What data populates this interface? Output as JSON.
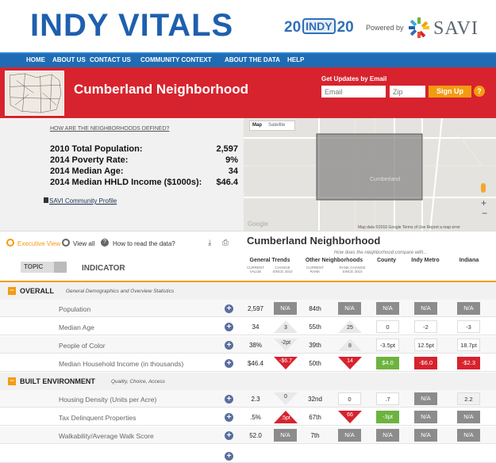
{
  "header": {
    "logo": "INDY VITALS",
    "indy20_left": "20",
    "indy20_mid": "INDY",
    "indy20_right": "20",
    "powered_by": "Powered by",
    "savi": "SAVI"
  },
  "nav": {
    "items": [
      "HOME",
      "ABOUT US",
      "CONTACT US",
      "COMMUNITY CONTEXT",
      "ABOUT THE DATA",
      "HELP"
    ]
  },
  "banner": {
    "title": "Cumberland Neighborhood",
    "updates_label": "Get Updates by Email",
    "email_placeholder": "Email",
    "zip_placeholder": "Zip",
    "signup": "Sign Up",
    "help": "?"
  },
  "stats": {
    "defined_link": "HOW ARE THE NEIGHBORHOODS DEFINED?",
    "items": [
      {
        "label": "2010 Total Population:",
        "value": "2,597"
      },
      {
        "label": "2014 Poverty Rate:",
        "value": "9%"
      },
      {
        "label": "2014 Median Age:",
        "value": "34"
      },
      {
        "label": "2014 Median HHLD Income ($1000s):",
        "value": "$46.4"
      }
    ],
    "profile_link": "SAVI Community Profile"
  },
  "map": {
    "tab_map": "Map",
    "tab_satellite": "Satellite",
    "label": "Cumberland",
    "footer": "Map data ©2016 Google   Terms of Use   Report a map error",
    "google": "Google"
  },
  "controls": {
    "executive_view": "Executive View",
    "view_all": "View all",
    "how_to_read": "How to read the data?",
    "section_title": "Cumberland Neighborhood",
    "compare_note": "How does the neighborhood compare with..."
  },
  "table_header": {
    "topic": "TOPIC",
    "indicator": "INDICATOR",
    "general_trends": "General Trends",
    "other_neighborhoods": "Other Neighborhoods",
    "county": "County",
    "indy_metro": "Indy Metro",
    "indiana": "Indiana",
    "sub_current_value": "CURRENT VALUE",
    "sub_change_since": "CHANGE SINCE 2010",
    "sub_current_rank": "CURRENT RANK",
    "sub_rank_change": "RANK CHANGE SINCE 2010"
  },
  "sections": [
    {
      "title": "OVERALL",
      "subtitle": "General Demographics and Overview Statistics",
      "rows": [
        {
          "indicator": "Population",
          "value": "2,597",
          "change": "N/A",
          "rank": "84th",
          "rank_change": "N/A",
          "county": "N/A",
          "metro": "N/A",
          "indiana": "N/A"
        },
        {
          "indicator": "Median Age",
          "value": "34",
          "change": "3",
          "rank": "55th",
          "rank_change": "25",
          "county": "0",
          "metro": "-2",
          "indiana": "-3"
        },
        {
          "indicator": "People of Color",
          "value": "38%",
          "change": "-2pt",
          "rank": "39th",
          "rank_change": "8",
          "county": "-3.5pt",
          "metro": "12.5pt",
          "indiana": "18.7pt"
        },
        {
          "indicator": "Median Household Income (in thousands)",
          "value": "$46.4",
          "change": "-$6.7",
          "rank": "50th",
          "rank_change": "14",
          "county": "$4.0",
          "metro": "-$6.0",
          "indiana": "-$2.3"
        }
      ]
    },
    {
      "title": "BUILT ENVIRONMENT",
      "subtitle": "Quality, Choice, Access",
      "rows": [
        {
          "indicator": "Housing Density (Units per Acre)",
          "value": "2.3",
          "change": "0",
          "rank": "32nd",
          "rank_change": "0",
          "county": ".7",
          "metro": "N/A",
          "indiana": "2.2"
        },
        {
          "indicator": "Tax Delinquent Properties",
          "value": ".5%",
          "change": ".5pt",
          "rank": "67th",
          "rank_change": "66",
          "county": "-3pt",
          "metro": "N/A",
          "indiana": "N/A"
        },
        {
          "indicator": "Walkability/Average Walk Score",
          "value": "52.0",
          "change": "N/A",
          "rank": "7th",
          "rank_change": "N/A",
          "county": "N/A",
          "metro": "N/A",
          "indiana": "N/A"
        }
      ]
    }
  ],
  "colors": {
    "brand_blue": "#1f5fae",
    "nav_blue": "#1f6cb4",
    "banner_red": "#d7232e",
    "accent_orange": "#f39c12",
    "good_green": "#6db33f",
    "neutral_gray": "#8c8c8c"
  }
}
